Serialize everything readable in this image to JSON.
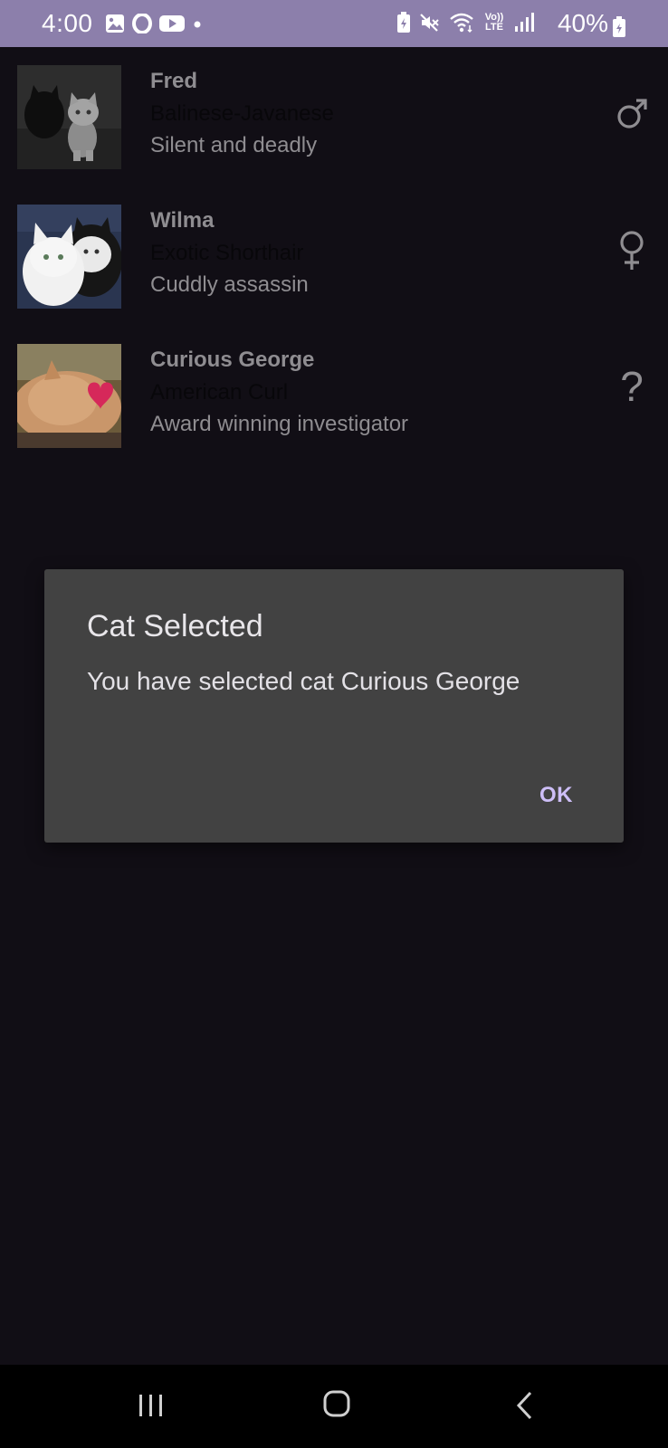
{
  "status_bar": {
    "time": "4:00",
    "battery": "40%",
    "left_icons": [
      "image-icon",
      "opera-icon",
      "youtube-icon",
      "dot-icon"
    ],
    "right_icons": [
      "battery-saver-icon",
      "mute-icon",
      "wifi-icon",
      "volte-icon",
      "signal-icon",
      "battery-icon"
    ],
    "volte_label": "Vo)) LTE"
  },
  "cats": [
    {
      "name": "Fred",
      "breed": "Balinese-Javanese",
      "description": "Silent and deadly",
      "gender_icon": "male-icon"
    },
    {
      "name": "Wilma",
      "breed": "Exotic Shorthair",
      "description": "Cuddly assassin",
      "gender_icon": "female-icon"
    },
    {
      "name": "Curious George",
      "breed": "American Curl",
      "description": "Award winning investigator",
      "gender_icon": "unknown-icon",
      "gender_glyph": "?"
    }
  ],
  "dialog": {
    "title": "Cat Selected",
    "message": "You have selected cat Curious George",
    "ok_label": "OK"
  },
  "nav_bar": {
    "icons": [
      "recent-apps-icon",
      "home-icon",
      "back-icon"
    ]
  },
  "colors": {
    "status_bar": "#8c7fab",
    "background": "#110e15",
    "dialog": "#424242",
    "accent": "#cdbef7"
  }
}
